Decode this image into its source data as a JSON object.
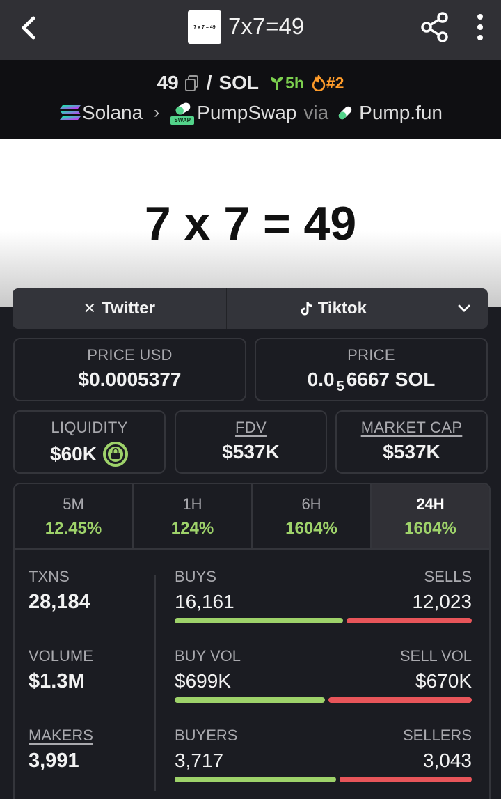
{
  "header": {
    "thumb_text": "7 x 7 = 49",
    "title": "7x7=49"
  },
  "pair": {
    "base": "49",
    "quote": "SOL",
    "age": "5h",
    "rank": "#2",
    "chain": "Solana",
    "dex": "PumpSwap",
    "dex_badge": "SWAP",
    "via": "via",
    "launchpad": "Pump.fun"
  },
  "banner": {
    "text": "7 x 7 = 49"
  },
  "links": [
    {
      "label": "Twitter",
      "icon": "x-icon"
    },
    {
      "label": "Tiktok",
      "icon": "tiktok-icon"
    }
  ],
  "prices": {
    "price_usd_label": "PRICE USD",
    "price_usd": "$0.0005377",
    "price_label": "PRICE",
    "price_sol_prefix": "0.0",
    "price_sol_zeros": "5",
    "price_sol_rest": "6667 SOL"
  },
  "metrics": {
    "liquidity_label": "LIQUIDITY",
    "liquidity": "$60K",
    "fdv_label": "FDV",
    "fdv": "$537K",
    "mcap_label": "MARKET CAP",
    "mcap": "$537K"
  },
  "periods": [
    {
      "label": "5M",
      "change": "12.45%"
    },
    {
      "label": "1H",
      "change": "124%"
    },
    {
      "label": "6H",
      "change": "1604%"
    },
    {
      "label": "24H",
      "change": "1604%"
    }
  ],
  "stats": {
    "txns_label": "TXNS",
    "txns": "28,184",
    "buys_label": "BUYS",
    "buys": "16,161",
    "sells_label": "SELLS",
    "sells": "12,023",
    "buys_share": 0.573,
    "volume_label": "VOLUME",
    "volume": "$1.3M",
    "buyvol_label": "BUY VOL",
    "buyvol": "$699K",
    "sellvol_label": "SELL VOL",
    "sellvol": "$670K",
    "buyvol_share": 0.511,
    "makers_label": "MAKERS",
    "makers": "3,991",
    "buyers_label": "BUYERS",
    "buyers": "3,717",
    "sellers_label": "SELLERS",
    "sellers": "3,043",
    "buyers_share": 0.55
  },
  "colors": {
    "positive": "#9ed26a",
    "negative": "#e8555a",
    "age": "#7ccf4f",
    "rank": "#ff9c2a"
  }
}
